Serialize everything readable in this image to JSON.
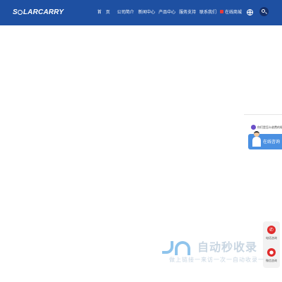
{
  "header": {
    "logo": {
      "before": "S",
      "after": "LARCARRY"
    },
    "nav": [
      {
        "label": "首　页"
      },
      {
        "label": "公司简介"
      },
      {
        "label": "新闻中心"
      },
      {
        "label": "产品中心"
      },
      {
        "label": "服务支持"
      },
      {
        "label": "联系我们"
      }
    ],
    "shop_label": "在线商城",
    "globe_icon": "globe-icon",
    "search_icon": "search-icon",
    "colors": {
      "header_bg": "#1e50a2",
      "search_bg": "#15306a"
    }
  },
  "consult": {
    "prompt": "你们是怎么收费的呢",
    "button_label": "在线咨询",
    "accent": "#4a90e2"
  },
  "side_tools": [
    {
      "label": "电话咨询",
      "icon": "phone-icon",
      "glyph": "✆"
    },
    {
      "label": "微信咨询",
      "icon": "wechat-icon",
      "glyph": "●"
    }
  ],
  "watermark": {
    "title": "自动秒收录",
    "subtitle": "做上链接一来访一次一自动收录一"
  }
}
